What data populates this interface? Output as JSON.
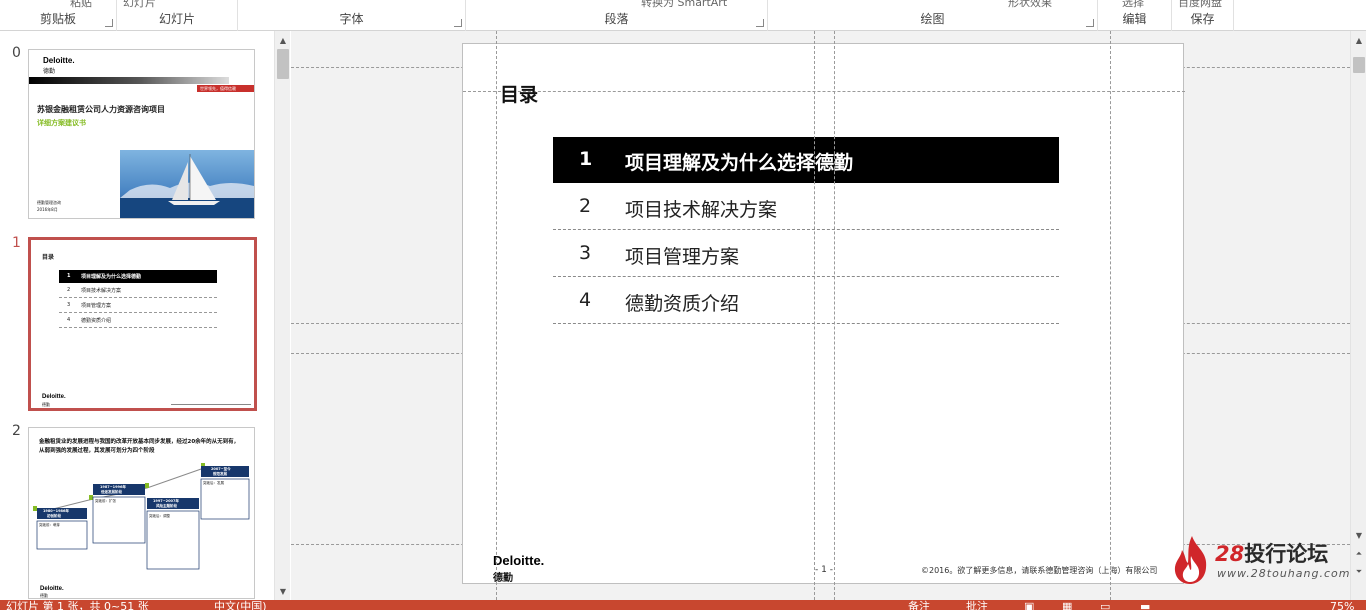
{
  "ribbon": {
    "groups": [
      {
        "label": "剪贴板",
        "top_fragment": "粘贴"
      },
      {
        "label": "幻灯片",
        "top_fragment": "幻灯片"
      },
      {
        "label": "字体",
        "top_fragment": ""
      },
      {
        "label": "段落",
        "top_fragment": "转换为 SmartArt"
      },
      {
        "label": "绘图",
        "top_fragment": "形状效果"
      },
      {
        "label": "编辑",
        "top_fragment": "选择"
      },
      {
        "label": "保存",
        "top_fragment": "百度网盘"
      }
    ]
  },
  "thumbnails": {
    "items": [
      {
        "number": "0",
        "brand": "Deloitte.",
        "brand_cn": "德勤",
        "banner": "世界领先，值得信赖",
        "title": "苏银金融租赁公司人力资源咨询项目",
        "subtitle": "详细方案建议书",
        "footer_line1": "德勤管理咨询",
        "footer_line2": "2016年8月"
      },
      {
        "number": "1",
        "title": "目录",
        "rows": [
          {
            "num": "1",
            "label": "项目理解及为什么选择德勤"
          },
          {
            "num": "2",
            "label": "项目技术解决方案"
          },
          {
            "num": "3",
            "label": "项目管理方案"
          },
          {
            "num": "4",
            "label": "德勤资质介绍"
          }
        ],
        "brand": "Deloitte.",
        "brand_cn": "德勤"
      },
      {
        "number": "2",
        "title": "金融租赁业的发展进程与我国的改革开放基本同步发展，经过20余年的从无到有，从弱到强的发展过程，其发展可划分为四个阶段",
        "stages": [
          {
            "years": "1980~1986年",
            "name": "初创阶段",
            "phase": "突破前：萌芽"
          },
          {
            "years": "1987~1996年",
            "name": "低迷发展阶段",
            "phase": "突破前：扩张"
          },
          {
            "years": "1997~2007年",
            "name": "风险主题阶段",
            "phase": "突破后：调整"
          },
          {
            "years": "2007~至今",
            "name": "规范发展",
            "phase": "突破后：发展"
          }
        ],
        "brand": "Deloitte.",
        "brand_cn": "德勤"
      }
    ]
  },
  "slide": {
    "title": "目录",
    "rows": [
      {
        "num": "1",
        "label": "项目理解及为什么选择德勤",
        "highlight": true
      },
      {
        "num": "2",
        "label": "项目技术解决方案",
        "highlight": false
      },
      {
        "num": "3",
        "label": "项目管理方案",
        "highlight": false
      },
      {
        "num": "4",
        "label": "德勤资质介绍",
        "highlight": false
      }
    ],
    "brand": "Deloitte.",
    "brand_cn": "德勤",
    "page": "- 1 -",
    "copyright": "©2016。欲了解更多信息，请联系德勤管理咨询（上海）有限公司"
  },
  "watermark": {
    "number": "28",
    "text": "投行论坛",
    "url": "www.28touhang.com"
  },
  "statusbar": {
    "slide_info": "幻灯片 第 1 张，共 0~51 张",
    "language": "中文(中国)",
    "notes": "备注",
    "comments": "批注",
    "zoom": "75%"
  },
  "colors": {
    "accent": "#c0504d",
    "status_bar": "#c8472f",
    "deloitte_green": "#86bc25",
    "highlight_row": "#000000"
  }
}
